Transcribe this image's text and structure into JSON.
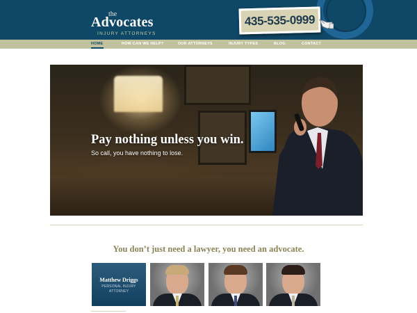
{
  "brand": {
    "the": "the",
    "name": "Advocates",
    "subtitle": "INJURY ATTORNEYS"
  },
  "phone": {
    "number": "435-535-0999",
    "icon": "hand-pointer-icon"
  },
  "nav": {
    "items": [
      {
        "label": "HOME",
        "active": true
      },
      {
        "label": "HOW CAN WE HELP?",
        "active": false
      },
      {
        "label": "OUR ATTORNEYS",
        "active": false
      },
      {
        "label": "INJURY TYPES",
        "active": false
      },
      {
        "label": "BLOG",
        "active": false
      },
      {
        "label": "CONTACT",
        "active": false
      }
    ]
  },
  "hero": {
    "headline": "Pay nothing unless you win.",
    "subline": "So call, you have nothing to lose."
  },
  "tagline": "You don’t just need a lawyer, you need an advocate.",
  "attorneys": {
    "featured": {
      "name": "Matthew Driggs",
      "title": "PERSONAL INJURY ATTORNEY"
    }
  },
  "colors": {
    "header_bg": "#0f4766",
    "nav_bg": "#c1c19d",
    "phone_card": "#d8d3b4",
    "tagline": "#8b8457"
  }
}
